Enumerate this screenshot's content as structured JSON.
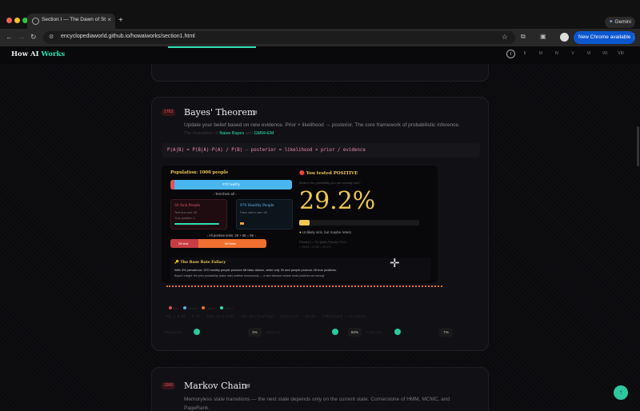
{
  "browser": {
    "tab_title": "Section I — The Dawn of Sta...",
    "tab_close": "×",
    "new_tab": "+",
    "url": "encyclopediaworld.github.io/howaiworks/section1.html",
    "update_button": "New Chrome available",
    "gemini_label": "Gemini",
    "back": "←",
    "forward": "→",
    "reload": "↻",
    "bookmark": "☆",
    "menu": "⋮"
  },
  "site": {
    "brand_main": "How AI ",
    "brand_accent": "Works",
    "eras": [
      "I",
      "II",
      "III",
      "IV",
      "V",
      "VI",
      "VII",
      "VIII"
    ],
    "active_era": "I"
  },
  "bayes": {
    "year": "1763",
    "title": "Bayes' Theorem",
    "subtitle": "Update your belief based on new evidence. Prior × likelihood → posterior. The core framework of probabilistic inference.",
    "related_prefix": "The foundation of",
    "related_link1": "Naive Bayes",
    "related_mid": "and",
    "related_link2": "GMM+EM",
    "formula_left": "P(A|B) = P(B|A)·P(A) / P(B)",
    "formula_sep": "—",
    "formula_right": "posterior = likelihood × prior / evidence",
    "demo": {
      "population_title": "Population: 1000 people",
      "healthy_label": "970 healthy",
      "test_all": "↓ Test them all ↓",
      "sick_title": "30 Sick People",
      "sick_line1": "Test true pos: 30",
      "sick_line2": "True positive: 1",
      "healthy_title": "970 Healthy People",
      "healthy_line1": "False alarm rate: 68",
      "all_positive": "↓ All positive tests: 28 + 68 = 96 ↓",
      "pos_sick_label": "28 sick",
      "pos_healthy_label": "68 false",
      "result_title": "🔴 You tested POSITIVE",
      "result_question": "What is the probability you are actually sick?",
      "result_pct": "29.2%",
      "result_fill": 0.292,
      "verdict": "Unlikely sick, but maybe retest.",
      "calc1": "P(sick|+) = P(+|sick)·P(sick) / P(+)",
      "calc2": "= 28/96 = 0.292 = 29.2%",
      "fallacy_title": "🔑 The Base Rate Fallacy",
      "fallacy_line1": "With 3% prevalence: 970 healthy people produce 68 false alarms, while only 30 sick people produce 28 true positives.",
      "fallacy_line2": "Bayes' insight: the prior probability (base rate) matters enormously — a rare disease means most positives are wrong!"
    },
    "legend": [
      "Sick",
      "Healthy",
      "False +",
      "True +"
    ],
    "code_line": "reg = 0.03 · 0.95 · sens p(+|sick) · fpr p(+|healthy) · posterior · prior · likelihood · evidence",
    "sliders": [
      {
        "label": "Prevalence",
        "value": "3%",
        "fill": 0.03
      },
      {
        "label": "Sensitivity",
        "value": "92%",
        "fill": 0.92
      },
      {
        "label": "False pos",
        "value": "7%",
        "fill": 0.07
      }
    ]
  },
  "markov": {
    "year": "1906",
    "title": "Markov Chain",
    "description": "Memoryless state transitions — the next state depends only on the current state. Cornerstone of HMM, MCMC, and PageRank."
  },
  "scroll_top_label": "↑",
  "colors": {
    "accent": "#2ee0b0",
    "gold": "#f0c850",
    "sick": "#e0505a",
    "healthy": "#4ab6f0",
    "false_positive": "#f07030"
  }
}
